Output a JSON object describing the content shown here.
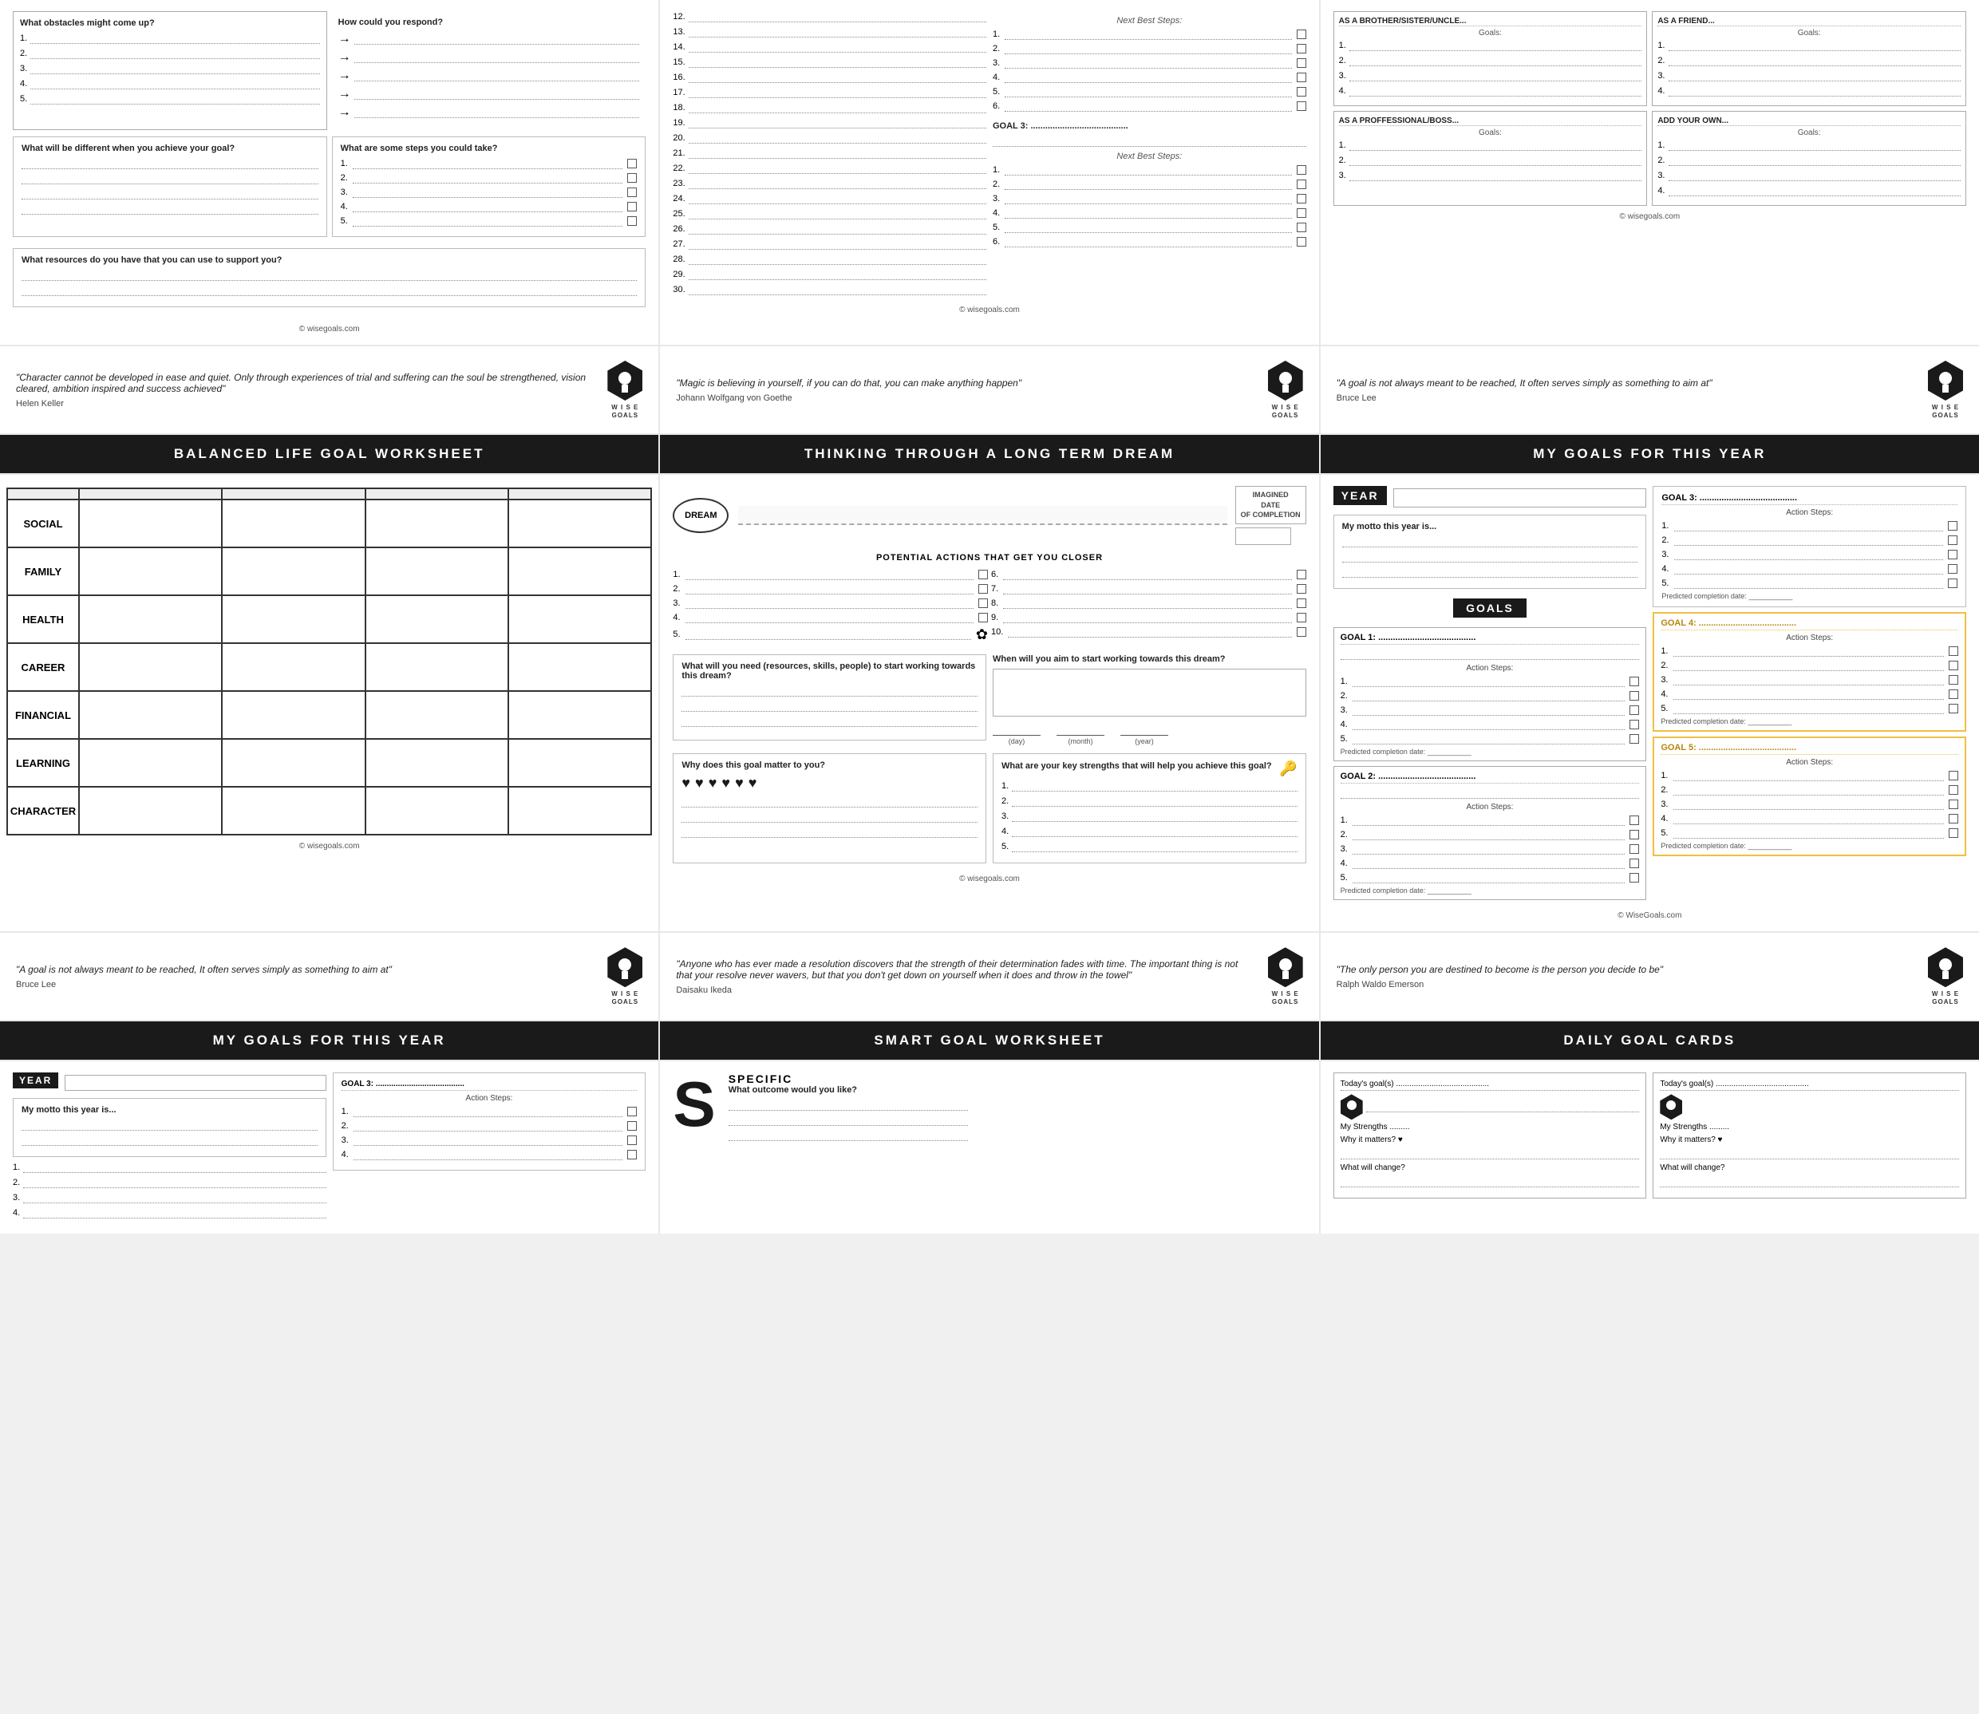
{
  "topRow": {
    "left": {
      "cols": {
        "obstacles": "What obstacles might come up?",
        "respond": "How could you respond?"
      },
      "items": [
        "1.",
        "2.",
        "3.",
        "4.",
        "5."
      ],
      "differentLabel": "What will be different when you achieve your goal?",
      "stepsLabel": "What are some steps you could take?",
      "resourcesLabel": "What resources do you have that you can use to support you?",
      "copyright": "© wisegoals.com"
    },
    "middle": {
      "numbers": [
        "12.",
        "13.",
        "14.",
        "15.",
        "16.",
        "17.",
        "18.",
        "19.",
        "20.",
        "21.",
        "22.",
        "23.",
        "24.",
        "25.",
        "26.",
        "27.",
        "28.",
        "29.",
        "30."
      ],
      "nextBestSteps1": "Next Best Steps:",
      "goal3Label": "GOAL 3: ........................................",
      "nextBestSteps2": "Next Best Steps:",
      "copyright": "© wisegoals.com"
    },
    "right": {
      "brotherHeader": "AS A BROTHER/SISTER/UNCLE...",
      "brotherGoals": "Goals:",
      "friendHeader": "AS A FRIEND...",
      "friendGoals": "Goals:",
      "professionalHeader": "AS A PROFFESSIONAL/BOSS...",
      "professionalGoals": "Goals:",
      "addOwnHeader": "ADD YOUR OWN...",
      "addOwnGoals": "Goals:",
      "copyright": "© wisegoals.com",
      "items": [
        "1.",
        "2.",
        "3.",
        "4."
      ]
    }
  },
  "quoteRow": {
    "left": {
      "text": "\"Character cannot be developed in ease and quiet. Only through experiences of trial and suffering can the soul be strengthened, vision cleared, ambition inspired and success achieved\"",
      "author": "Helen Keller",
      "logo": "W I S E\nGOALS"
    },
    "middle": {
      "text": "\"Magic is believing in yourself, if you can do that, you can make anything happen\"",
      "author": "Johann Wolfgang von Goethe",
      "logo": "W I S E\nGOALS"
    },
    "right": {
      "text": "\"A goal is not always meant to be reached, It often serves simply as something to aim at\"",
      "author": "Bruce Lee",
      "logo": "W I S E\nGOALS"
    }
  },
  "worksheetHeaders": {
    "left": "BALANCED LIFE GOAL WORKSHEET",
    "middle": "THINKING THROUGH A LONG TERM DREAM",
    "right": "MY GOALS FOR THIS YEAR"
  },
  "balancedLife": {
    "rows": [
      "SOCIAL",
      "FAMILY",
      "HEALTH",
      "CAREER",
      "FINANCIAL",
      "LEARNING",
      "CHARACTER"
    ],
    "copyright": "© wisegoals.com"
  },
  "longTermDream": {
    "dreamLabel": "DREAM",
    "imaginedLabel": "IMAGINED\nDATE\nOF COMPLETION",
    "potentialHeader": "POTENTIAL ACTIONS THAT GET YOU CLOSER",
    "items1": [
      "1.",
      "2.",
      "3.",
      "4.",
      "5."
    ],
    "items2": [
      "6.",
      "7.",
      "8.",
      "9.",
      "10."
    ],
    "resourcesLabel": "What will you need (resources, skills, people) to start working towards this dream?",
    "startLabel": "When will you aim to start working towards this dream?",
    "dayLabel": "(day)",
    "monthLabel": "(month)",
    "yearLabel": "(year)",
    "matterLabel": "Why does this goal matter to you?",
    "strengthsLabel": "What are your key strengths that will help you achieve this goal?",
    "strengthItems": [
      "1.",
      "2.",
      "3.",
      "4.",
      "5."
    ],
    "hearts": [
      "♥",
      "♥",
      "♥",
      "♥",
      "♥",
      "♥"
    ],
    "keyIcon": "🔑",
    "copyright": "© wisegoals.com"
  },
  "goalsThisYear": {
    "yearLabel": "YEAR",
    "mottoLabel": "My motto this year is...",
    "goalsLabel": "GOALS",
    "goal1Label": "GOAL 1: ........................................",
    "goal2Label": "GOAL 2: ........................................",
    "goal3Label": "GOAL 3: ........................................",
    "goal4Label": "GOAL 4: ........................................",
    "goal5Label": "GOAL 5: ........................................",
    "actionStepsLabel": "Action Steps:",
    "completionLabel": "Predicted completion date: ___________",
    "items": [
      "1.",
      "2.",
      "3.",
      "4.",
      "5."
    ],
    "copyright": "© WiseGoals.com"
  },
  "secondQuoteRow": {
    "left": {
      "text": "\"A goal is not always meant to be reached, It often serves simply as something to aim at\"",
      "author": "Bruce Lee"
    },
    "middle": {
      "text": "\"Anyone who has ever made a resolution discovers that the strength of their determination fades with time. The important thing is not that your resolve never wavers, but that you don't get down on yourself when it does and throw in the towel\"",
      "author": "Daisaku Ikeda"
    },
    "right": {
      "text": "\"The only person you are destined to become is the person you decide to be\"",
      "author": "Ralph Waldo Emerson"
    }
  },
  "bottomHeaders": {
    "left": "MY GOALS FOR THIS YEAR",
    "middle": "SMART GOAL WORKSHEET",
    "right": "DAILY GOAL CARDS"
  },
  "smartGoal": {
    "letter": "S",
    "specificLabel": "SPECIFIC",
    "specificQuestion": "What outcome would you like?"
  },
  "dailyCards": {
    "card1Title": "Today's goal(s) ..........................................",
    "card2Title": "Today's goal(s) ..........................................",
    "strengthsLabel": "My Strengths .........",
    "whyLabel": "Why it matters? ♥",
    "changeLabel": "What will change?"
  }
}
